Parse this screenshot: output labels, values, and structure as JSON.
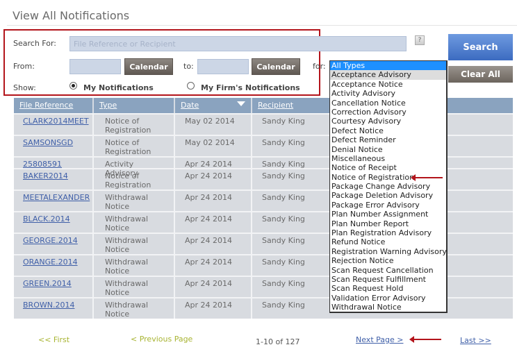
{
  "page_title": "View All Notifications",
  "search": {
    "search_for_label": "Search For:",
    "placeholder": "File Reference or Recipient",
    "help_label": "?",
    "from_label": "From:",
    "to_label": "to:",
    "for_label": "for:",
    "calendar_label": "Calendar",
    "show_label": "Show:",
    "radio_my": "My Notifications",
    "radio_firm": "My Firm's Notifications",
    "selected_show": "My Notifications",
    "search_button": "Search",
    "clear_button": "Clear All"
  },
  "type_dropdown": {
    "selected": "All Types",
    "options": [
      "All Types",
      "Acceptance Advisory",
      "Acceptance Notice",
      "Activity Advisory",
      "Cancellation Notice",
      "Correction Advisory",
      "Courtesy Advisory",
      "Defect Notice",
      "Defect Reminder",
      "Denial Notice",
      "Miscellaneous",
      "Notice of Receipt",
      "Notice of Registration",
      "Package Change Advisory",
      "Package Deletion Advisory",
      "Package Error Advisory",
      "Plan Number Assignment",
      "Plan Number Report",
      "Plan Registration Advisory",
      "Refund Notice",
      "Registration Warning Advisory",
      "Rejection Notice",
      "Scan Request Cancellation",
      "Scan Request Fulfillment",
      "Scan Request Hold",
      "Validation Error Advisory",
      "Withdrawal Notice"
    ],
    "hovered": "Acceptance Advisory"
  },
  "table": {
    "columns": [
      "File Reference",
      "Type",
      "Date",
      "Recipient"
    ],
    "sorted_by": "Date",
    "rows": [
      [
        "CLARK2014MEET",
        "Notice of Registration",
        "May 02 2014",
        "Sandy King"
      ],
      [
        "SAMSONSGD",
        "Notice of Registration",
        "May 02 2014",
        "Sandy King"
      ],
      [
        "25808591",
        "Activity Advisory",
        "Apr 24 2014",
        "Sandy King"
      ],
      [
        "BAKER2014",
        "Notice of Registration",
        "Apr 24 2014",
        "Sandy King"
      ],
      [
        "MEETALEXANDER",
        "Withdrawal Notice",
        "Apr 24 2014",
        "Sandy King"
      ],
      [
        "BLACK.2014",
        "Withdrawal Notice",
        "Apr 24 2014",
        "Sandy King"
      ],
      [
        "GEORGE.2014",
        "Withdrawal Notice",
        "Apr 24 2014",
        "Sandy King"
      ],
      [
        "ORANGE.2014",
        "Withdrawal Notice",
        "Apr 24 2014",
        "Sandy King"
      ],
      [
        "GREEN.2014",
        "Withdrawal Notice",
        "Apr 24 2014",
        "Sandy King"
      ],
      [
        "BROWN.2014",
        "Withdrawal Notice",
        "Apr 24 2014",
        "Sandy King"
      ]
    ]
  },
  "pagination": {
    "first": "<< First",
    "previous": "< Previous Page",
    "range": "1-10 of 127",
    "next": "Next Page >",
    "last": "Last >>"
  },
  "colors": {
    "annotation": "#b3141b",
    "header": "#8aa3bf",
    "link": "#3f5fa8",
    "disabled_link": "#a8b432"
  }
}
